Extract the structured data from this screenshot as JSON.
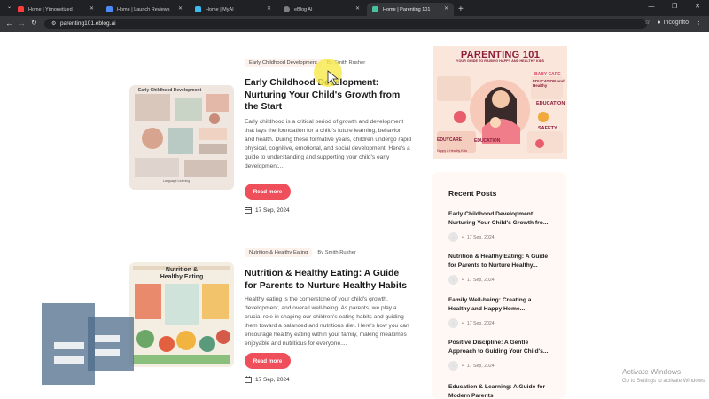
{
  "browser": {
    "tabs": [
      {
        "label": "Home | Ytmonetized",
        "color": "#ff3b3b"
      },
      {
        "label": "Home | Launch Reviews",
        "color": "#4c8bf5"
      },
      {
        "label": "Home | MyAI",
        "color": "#3dbbf0"
      },
      {
        "label": "eBlog AI",
        "color": "#7e7e7e"
      },
      {
        "label": "Home | Parenting 101",
        "color": "#49c39e"
      }
    ],
    "url": "parenting101.eblog.ai",
    "incognito_label": "Incognito"
  },
  "posts": [
    {
      "category": "Early Childhood Development",
      "author": "By Smith Rusher",
      "title": "Early Childhood Development: Nurturing Your Child's Growth from the Start",
      "excerpt": "Early childhood is a critical period of growth and development that lays the foundation for a child's future learning, behavior, and health. During these formative years, children undergo rapid physical, cognitive, emotional, and social development. Here's a guide to understanding and supporting your child's early development....",
      "button": "Read more",
      "date": "17 Sep, 2024",
      "thumb_caption": "Early Childhood Development",
      "thumb_caption2": "Language Learning"
    },
    {
      "category": "Nutrition & Healthy Eating",
      "author": "By Smith Rusher",
      "title": "Nutrition & Healthy Eating: A Guide for Parents to Nurture Healthy Habits",
      "excerpt": "Healthy eating is the cornerstone of your child's growth, development, and overall well-being. As parents, we play a crucial role in shaping our children's eating habits and guiding them toward a balanced and nutritious diet. Here's how you can encourage healthy eating within your family, making mealtimes enjoyable and nutritious for everyone....",
      "button": "Read more",
      "date": "17 Sep, 2024",
      "thumb_caption": "Nutrition & Healthy Eating"
    }
  ],
  "sidebar": {
    "banner": {
      "title": "PARENTING 101",
      "subtitle": "YOUR GUIDE TO RAISING HAPPY AND HEALTHY KIDS",
      "labels": [
        "BABY CARE",
        "EDUCATION and Healthy",
        "EDUCATION",
        "SAFETY",
        "EDUYCARE",
        "EDUCATION",
        "Happy & Healthy Kids"
      ]
    },
    "recent_heading": "Recent Posts",
    "recent": [
      {
        "title": "Early Childhood Development: Nurturing Your Child's Growth fro...",
        "date": "17 Sep, 2024"
      },
      {
        "title": "Nutrition & Healthy Eating: A Guide for Parents to Nurture Healthy...",
        "date": "17 Sep, 2024"
      },
      {
        "title": "Family Well-being: Creating a Healthy and Happy Home...",
        "date": "17 Sep, 2024"
      },
      {
        "title": "Positive Discipline: A Gentle Approach to Guiding Your Child's...",
        "date": "17 Sep, 2024"
      },
      {
        "title": "Education & Learning: A Guide for Modern Parents",
        "date": ""
      }
    ]
  },
  "watermark": {
    "title": "Activate Windows",
    "subtitle": "Go to Settings to activate Windows."
  }
}
